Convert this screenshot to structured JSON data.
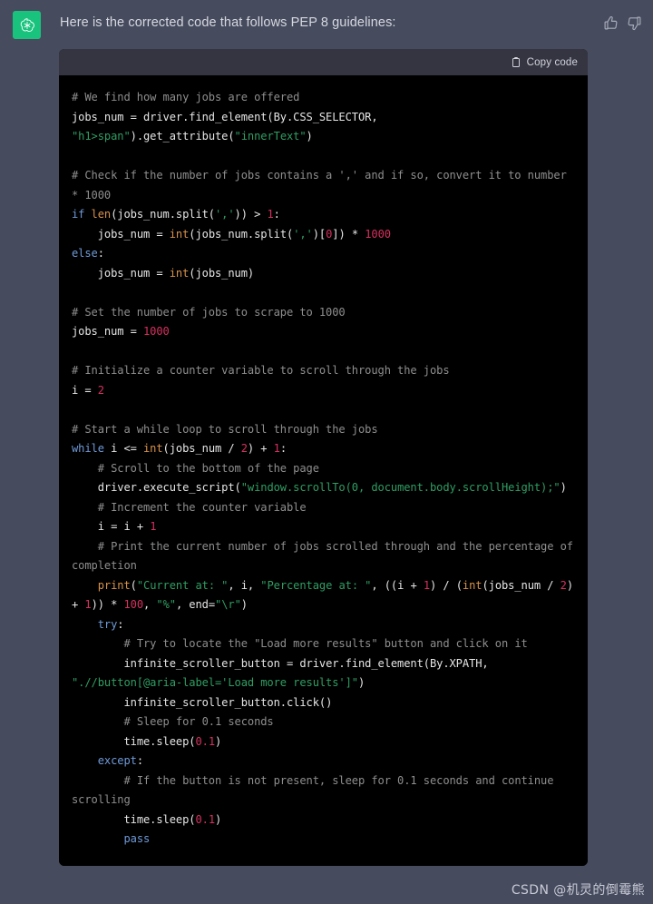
{
  "message": {
    "avatar_icon": "openai-logo-icon",
    "text": "Here is the corrected code that follows PEP 8 guidelines:",
    "feedback": {
      "thumbs_up_icon": "thumbs-up-icon",
      "thumbs_down_icon": "thumbs-down-icon"
    }
  },
  "code_block": {
    "copy_label": "Copy code",
    "copy_icon": "clipboard-icon",
    "language": "python",
    "lines": [
      [
        {
          "t": "# We find how many jobs are offered",
          "c": "c"
        }
      ],
      [
        {
          "t": "jobs_num = driver.find_element(By.CSS_SELECTOR, ",
          "c": "p"
        },
        {
          "t": "\"h1>span\"",
          "c": "s"
        },
        {
          "t": ").get_attribute(",
          "c": "p"
        },
        {
          "t": "\"innerText\"",
          "c": "s"
        },
        {
          "t": ")",
          "c": "p"
        }
      ],
      [
        {
          "t": "",
          "c": "p"
        }
      ],
      [
        {
          "t": "# Check if the number of jobs contains a ',' and if so, convert it to number * 1000",
          "c": "c"
        }
      ],
      [
        {
          "t": "if ",
          "c": "k"
        },
        {
          "t": "len",
          "c": "b"
        },
        {
          "t": "(jobs_num.split(",
          "c": "p"
        },
        {
          "t": "','",
          "c": "s"
        },
        {
          "t": ")) > ",
          "c": "p"
        },
        {
          "t": "1",
          "c": "n"
        },
        {
          "t": ":",
          "c": "p"
        }
      ],
      [
        {
          "t": "    jobs_num = ",
          "c": "p"
        },
        {
          "t": "int",
          "c": "b"
        },
        {
          "t": "(jobs_num.split(",
          "c": "p"
        },
        {
          "t": "','",
          "c": "s"
        },
        {
          "t": ")[",
          "c": "p"
        },
        {
          "t": "0",
          "c": "n"
        },
        {
          "t": "]) * ",
          "c": "p"
        },
        {
          "t": "1000",
          "c": "n"
        }
      ],
      [
        {
          "t": "else",
          "c": "k"
        },
        {
          "t": ":",
          "c": "p"
        }
      ],
      [
        {
          "t": "    jobs_num = ",
          "c": "p"
        },
        {
          "t": "int",
          "c": "b"
        },
        {
          "t": "(jobs_num)",
          "c": "p"
        }
      ],
      [
        {
          "t": "",
          "c": "p"
        }
      ],
      [
        {
          "t": "# Set the number of jobs to scrape to 1000",
          "c": "c"
        }
      ],
      [
        {
          "t": "jobs_num = ",
          "c": "p"
        },
        {
          "t": "1000",
          "c": "n"
        }
      ],
      [
        {
          "t": "",
          "c": "p"
        }
      ],
      [
        {
          "t": "# Initialize a counter variable to scroll through the jobs",
          "c": "c"
        }
      ],
      [
        {
          "t": "i = ",
          "c": "p"
        },
        {
          "t": "2",
          "c": "n"
        }
      ],
      [
        {
          "t": "",
          "c": "p"
        }
      ],
      [
        {
          "t": "# Start a while loop to scroll through the jobs",
          "c": "c"
        }
      ],
      [
        {
          "t": "while ",
          "c": "k"
        },
        {
          "t": "i <= ",
          "c": "p"
        },
        {
          "t": "int",
          "c": "b"
        },
        {
          "t": "(jobs_num / ",
          "c": "p"
        },
        {
          "t": "2",
          "c": "n"
        },
        {
          "t": ") + ",
          "c": "p"
        },
        {
          "t": "1",
          "c": "n"
        },
        {
          "t": ":",
          "c": "p"
        }
      ],
      [
        {
          "t": "    # Scroll to the bottom of the page",
          "c": "c"
        }
      ],
      [
        {
          "t": "    driver.execute_script(",
          "c": "p"
        },
        {
          "t": "\"window.scrollTo(0, document.body.scrollHeight);\"",
          "c": "s"
        },
        {
          "t": ")",
          "c": "p"
        }
      ],
      [
        {
          "t": "    # Increment the counter variable",
          "c": "c"
        }
      ],
      [
        {
          "t": "    i = i + ",
          "c": "p"
        },
        {
          "t": "1",
          "c": "n"
        }
      ],
      [
        {
          "t": "    # Print the current number of jobs scrolled through and the percentage of completion",
          "c": "c"
        }
      ],
      [
        {
          "t": "    ",
          "c": "p"
        },
        {
          "t": "print",
          "c": "b"
        },
        {
          "t": "(",
          "c": "p"
        },
        {
          "t": "\"Current at: \"",
          "c": "s"
        },
        {
          "t": ", i, ",
          "c": "p"
        },
        {
          "t": "\"Percentage at: \"",
          "c": "s"
        },
        {
          "t": ", ((i + ",
          "c": "p"
        },
        {
          "t": "1",
          "c": "n"
        },
        {
          "t": ") / (",
          "c": "p"
        },
        {
          "t": "int",
          "c": "b"
        },
        {
          "t": "(jobs_num / ",
          "c": "p"
        },
        {
          "t": "2",
          "c": "n"
        },
        {
          "t": ") + ",
          "c": "p"
        },
        {
          "t": "1",
          "c": "n"
        },
        {
          "t": ")) * ",
          "c": "p"
        },
        {
          "t": "100",
          "c": "n"
        },
        {
          "t": ", ",
          "c": "p"
        },
        {
          "t": "\"%\"",
          "c": "s"
        },
        {
          "t": ", end=",
          "c": "p"
        },
        {
          "t": "\"\\r\"",
          "c": "s"
        },
        {
          "t": ")",
          "c": "p"
        }
      ],
      [
        {
          "t": "    try",
          "c": "k"
        },
        {
          "t": ":",
          "c": "p"
        }
      ],
      [
        {
          "t": "        # Try to locate the \"Load more results\" button and click on it",
          "c": "c"
        }
      ],
      [
        {
          "t": "        infinite_scroller_button = driver.find_element(By.XPATH, ",
          "c": "p"
        },
        {
          "t": "\".//button[@aria-label='Load more results']\"",
          "c": "s"
        },
        {
          "t": ")",
          "c": "p"
        }
      ],
      [
        {
          "t": "        infinite_scroller_button.click()",
          "c": "p"
        }
      ],
      [
        {
          "t": "        # Sleep for 0.1 seconds",
          "c": "c"
        }
      ],
      [
        {
          "t": "        time.sleep(",
          "c": "p"
        },
        {
          "t": "0.1",
          "c": "n"
        },
        {
          "t": ")",
          "c": "p"
        }
      ],
      [
        {
          "t": "    except",
          "c": "k"
        },
        {
          "t": ":",
          "c": "p"
        }
      ],
      [
        {
          "t": "        # If the button is not present, sleep for 0.1 seconds and continue scrolling",
          "c": "c"
        }
      ],
      [
        {
          "t": "        time.sleep(",
          "c": "p"
        },
        {
          "t": "0.1",
          "c": "n"
        },
        {
          "t": ")",
          "c": "p"
        }
      ],
      [
        {
          "t": "        pass",
          "c": "k"
        }
      ]
    ]
  },
  "watermark": {
    "text": "CSDN @机灵的倒霉熊"
  },
  "colors": {
    "page_background": "#464b5e",
    "code_background": "#000000",
    "code_header_background": "#343541",
    "avatar_green": "#19c37d",
    "comment": "#8e8e8e",
    "keyword": "#6f9ad8",
    "builtin": "#d9924a",
    "string": "#2f9e63",
    "number": "#d6305f",
    "plain_text": "#e6e6e6"
  }
}
